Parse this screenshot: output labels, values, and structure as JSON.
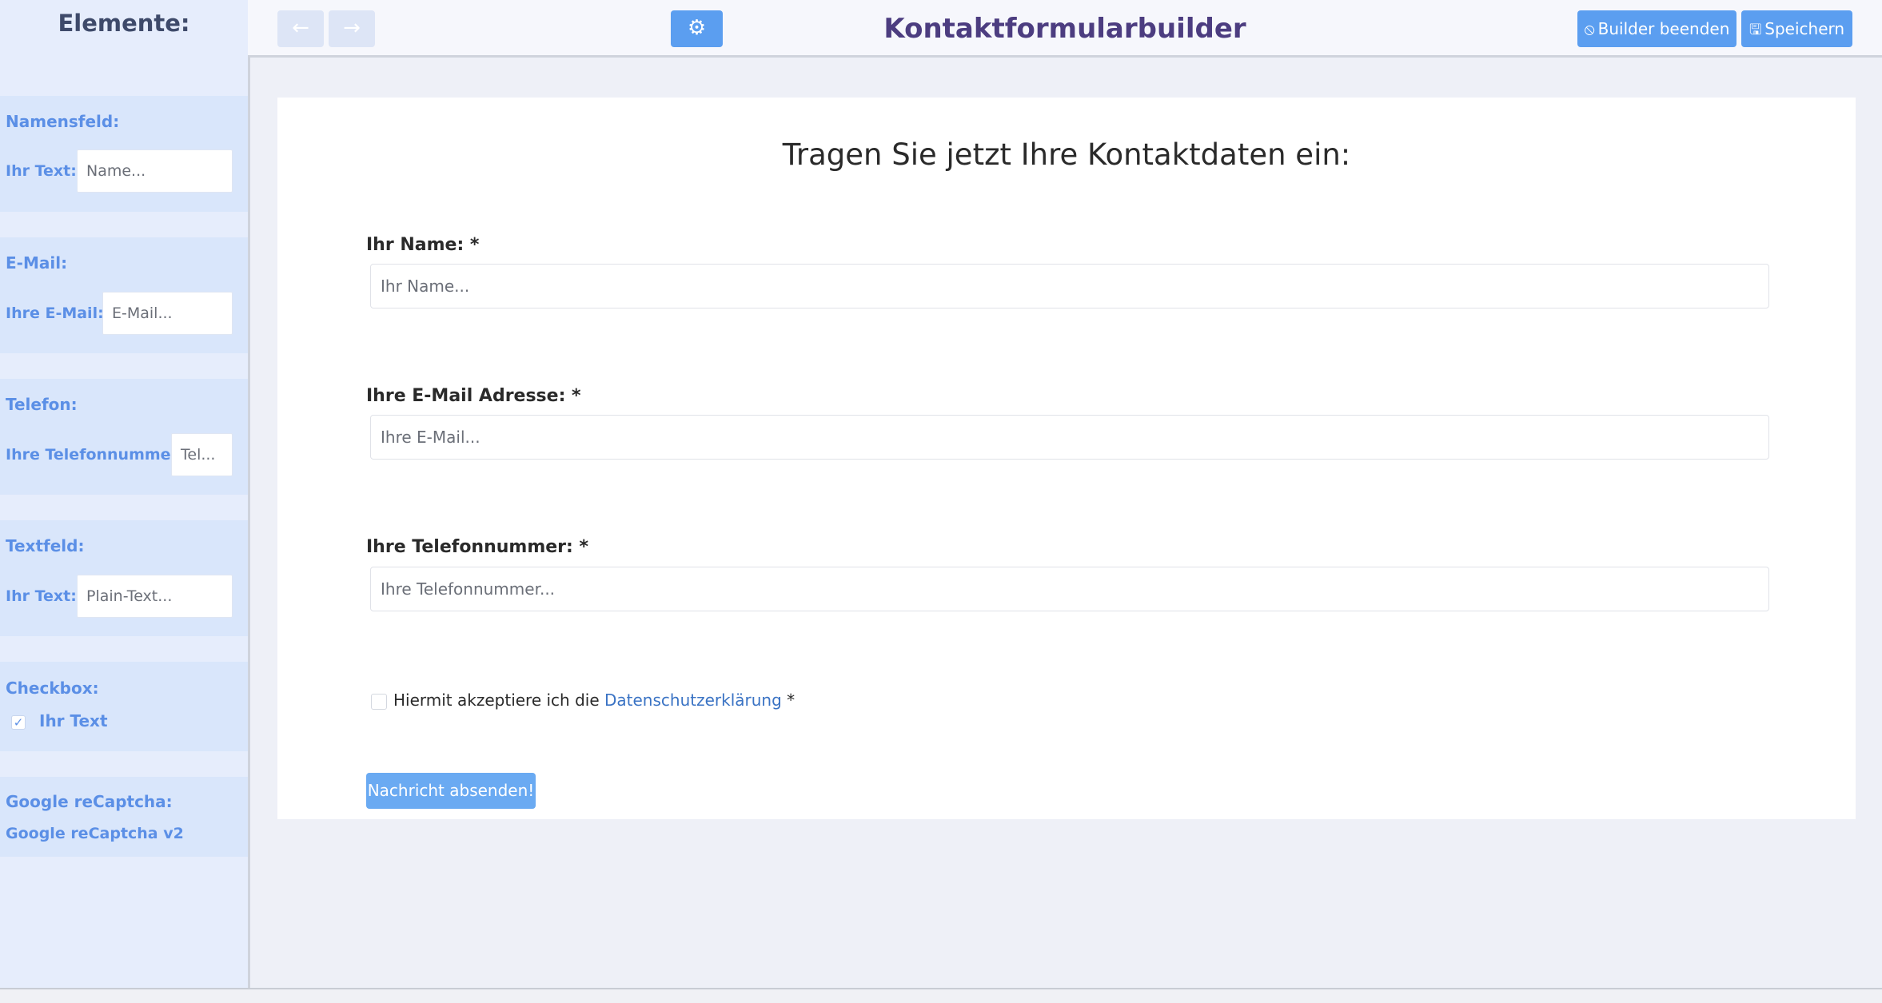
{
  "sidebar": {
    "title": "Elemente:",
    "elements": [
      {
        "heading": "Namensfeld:",
        "field_label": "Ihr Text:",
        "field_value": "Name..."
      },
      {
        "heading": "E-Mail:",
        "field_label": "Ihre E-Mail:",
        "field_value": "E-Mail..."
      },
      {
        "heading": "Telefon:",
        "field_label": "Ihre Telefonnummer:",
        "field_value": "Tel..."
      },
      {
        "heading": "Textfeld:",
        "field_label": "Ihr Text:",
        "field_value": "Plain-Text..."
      },
      {
        "heading": "Checkbox:",
        "field_label": "Ihr Text",
        "checkbox_mark": "✓"
      },
      {
        "heading": "Google reCaptcha:",
        "field_label": "Google reCaptcha v2"
      }
    ]
  },
  "header": {
    "back_icon": "arrow-left-icon",
    "forward_icon": "arrow-right-icon",
    "settings_icon": "gears-icon",
    "back_glyph": "←",
    "forward_glyph": "→",
    "settings_glyph": "⚙",
    "title": "Kontaktformularbuilder",
    "end_builder_icon_glyph": "⦸",
    "end_builder_label": "Builder beenden",
    "save_icon_glyph": "🖫",
    "save_label": "Speichern"
  },
  "form": {
    "heading": "Tragen Sie jetzt Ihre Kontaktdaten ein:",
    "fields": [
      {
        "label": "Ihr Name: *",
        "placeholder": "Ihr Name..."
      },
      {
        "label": "Ihre E-Mail Adresse: *",
        "placeholder": "Ihre E-Mail..."
      },
      {
        "label": "Ihre Telefonnummer: *",
        "placeholder": "Ihre Telefonnummer..."
      }
    ],
    "privacy": {
      "text_before": "Hiermit akzeptiere ich die ",
      "link_text": "Datenschutzerklärung",
      "text_after": " *"
    },
    "submit_label": "Nachricht absenden!"
  },
  "colors": {
    "accent": "#5b9ef0",
    "title": "#4c3d80",
    "sidebar_bg": "#e6edfc",
    "sidebar_block": "#d9e6fb",
    "sidebar_text": "#5b8fe6",
    "link": "#3a73c4"
  }
}
